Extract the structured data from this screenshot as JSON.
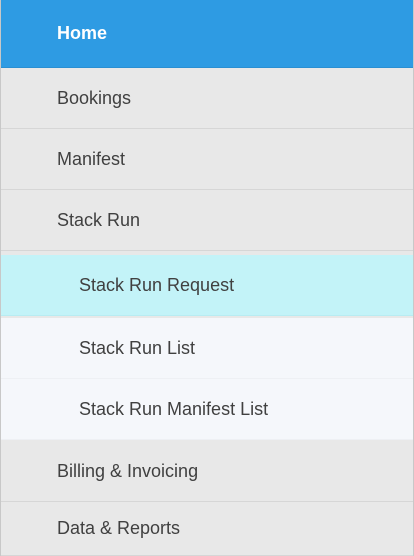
{
  "nav": {
    "items": [
      {
        "label": "Home"
      },
      {
        "label": "Bookings"
      },
      {
        "label": "Manifest"
      },
      {
        "label": "Stack Run"
      }
    ],
    "stack_run_sub": [
      {
        "label": "Stack Run Request"
      },
      {
        "label": "Stack Run List"
      },
      {
        "label": "Stack Run Manifest List"
      }
    ],
    "bottom_items": [
      {
        "label": "Billing & Invoicing"
      },
      {
        "label": "Data & Reports"
      }
    ]
  },
  "colors": {
    "active_bg": "#2e9be3",
    "selected_bg": "#c3f3f8",
    "submenu_bg": "#f5f7fb",
    "menu_bg": "#e8e8e8",
    "text": "#404040"
  }
}
